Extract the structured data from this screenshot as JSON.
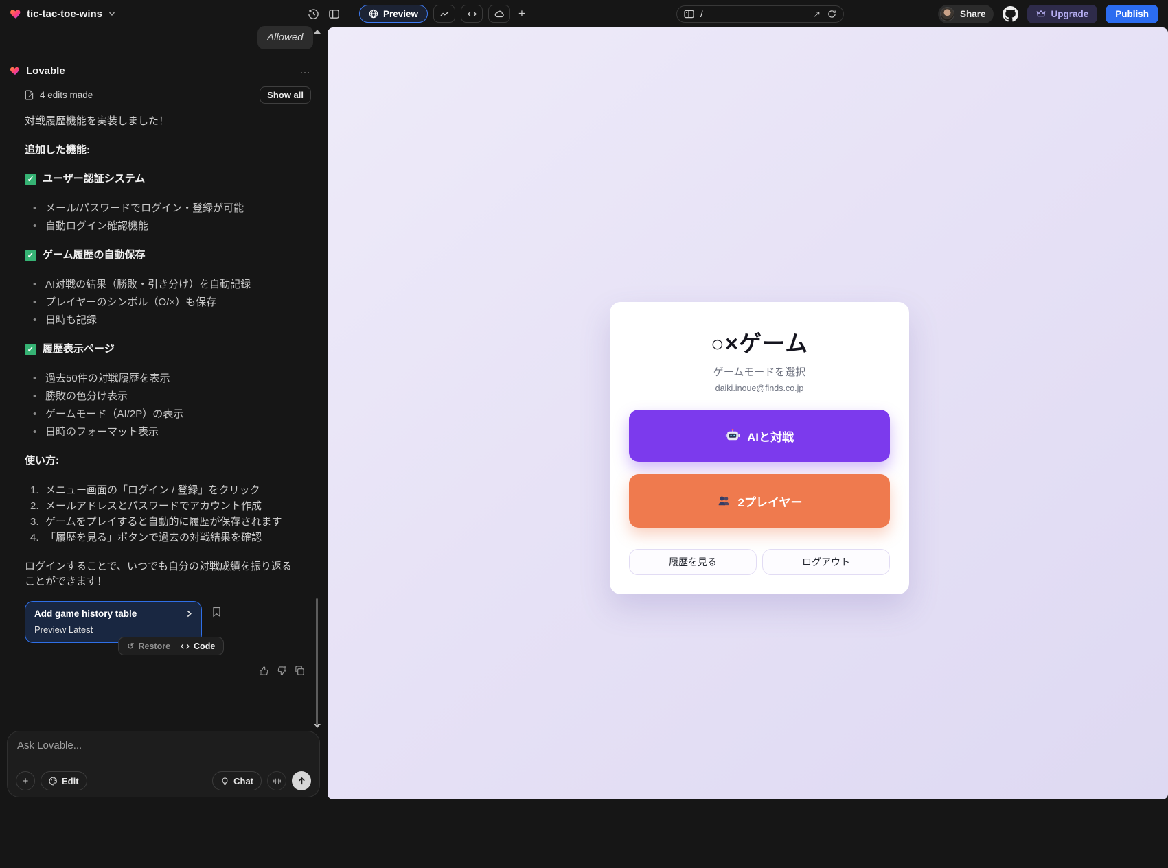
{
  "topbar": {
    "project_name": "tic-tac-toe-wins",
    "preview_tab": "Preview",
    "url_path": "/",
    "share": "Share",
    "upgrade": "Upgrade",
    "publish": "Publish"
  },
  "sidebar": {
    "allowed_badge": "Allowed",
    "agent": "Lovable",
    "edits": "4 edits made",
    "show_all": "Show all",
    "message": {
      "intro": "対戦履歴機能を実装しました！",
      "features_heading": "追加した機能:",
      "sections": [
        {
          "title": "ユーザー認証システム",
          "bullets": [
            "メール/パスワードでログイン・登録が可能",
            "自動ログイン確認機能"
          ]
        },
        {
          "title": "ゲーム履歴の自動保存",
          "bullets": [
            "AI対戦の結果（勝敗・引き分け）を自動記録",
            "プレイヤーのシンボル（O/×）も保存",
            "日時も記録"
          ]
        },
        {
          "title": "履歴表示ページ",
          "bullets": [
            "過去50件の対戦履歴を表示",
            "勝敗の色分け表示",
            "ゲームモード（AI/2P）の表示",
            "日時のフォーマット表示"
          ]
        }
      ],
      "usage_heading": "使い方:",
      "steps": [
        "メニュー画面の「ログイン / 登録」をクリック",
        "メールアドレスとパスワードでアカウント作成",
        "ゲームをプレイすると自動的に履歴が保存されます",
        "「履歴を見る」ボタンで過去の対戦結果を確認"
      ],
      "outro": "ログインすることで、いつでも自分の対戦成績を振り返ることができます！"
    },
    "version_card": {
      "title": "Add game history table",
      "status": "Preview Latest"
    },
    "restore": "Restore",
    "code": "Code"
  },
  "composer": {
    "placeholder": "Ask Lovable...",
    "edit": "Edit",
    "chat": "Chat"
  },
  "preview": {
    "title": "○×ゲーム",
    "subtitle": "ゲームモードを選択",
    "email": "daiki.inoue@finds.co.jp",
    "ai_button": "AIと対戦",
    "two_player_button": "2プレイヤー",
    "history_button": "履歴を見る",
    "logout_button": "ログアウト"
  },
  "icons": {
    "external_link": "↗",
    "undo": "↺",
    "ellipsis": "…",
    "check": "✓",
    "plus": "+"
  },
  "colors": {
    "accent_purple": "#7c3aed",
    "accent_orange": "#ef7a4e",
    "publish_blue": "#2b6cf0",
    "preview_border": "#3f83f8",
    "success_green": "#36b374"
  }
}
